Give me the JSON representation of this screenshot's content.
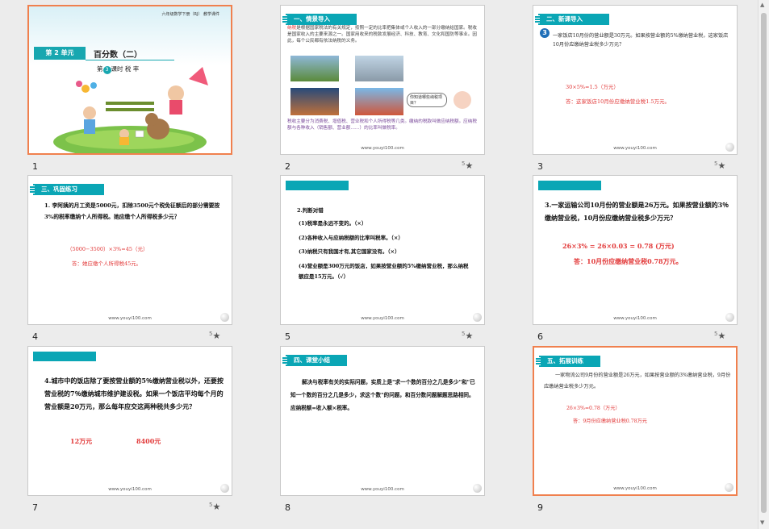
{
  "slides": [
    {
      "num": "1",
      "header": "六年级数学下册（RJ）  教学课件",
      "unit": "第 2 单元",
      "title": "百分数（二）",
      "lesson_pre": "第",
      "lesson_num": "3",
      "lesson_post": "课时  税 率"
    },
    {
      "num": "2",
      "banner": "一、情景导入",
      "text_pre": "纳税",
      "text": "是根据国家税法的有关规定，按照一定的比率把集体或个人收入的一部分缴纳给国家。税收是国家收入的主要来源之一。国家用收来的税款发展经济、科技、教育、文化和国防等事业。因此，每个公民都有依法纳税的义务。",
      "bubble": "你知道哪些纳税项目？",
      "text2": "税收主要分为消费税、增值税、营业税和个人所得税等几类。缴纳的税款叫做应纳税额。应纳税额与各种收入（销售额、营业额……）的比率叫做税率。",
      "footer": "www.youyi100.com"
    },
    {
      "num": "3",
      "banner": "二、新课导入",
      "badge": "3",
      "problem": "一家饭店10月份的营业额是30万元。如果按营业额的5%缴纳营业税，这家饭店10月份应缴纳营业税多少万元？",
      "calc": "30×5%=1.5（万元）",
      "answer": "答：这家饭店10月份应缴纳营业税1.5万元。",
      "footer": "www.youyi100.com"
    },
    {
      "num": "4",
      "banner": "三、巩固练习",
      "problem": "1. 李阿姨的月工资是5000元，扣除3500元个税免征额后的部分需要按3%的税率缴纳个人所得税。她应缴个人所得税多少元？",
      "calc": "（5000−3500）×3%=45（元）",
      "answer": "答：她应缴个人所得税45元。",
      "footer": "www.youyi100.com"
    },
    {
      "num": "5",
      "title": "2.判断对错",
      "items": [
        "(1)税率是永远不变的。（×）",
        "(2)各种收入与应纳税额的比率叫税率。（×）",
        "(3)纳税只有我国才有,其它国家没有。（×）",
        "(4)营业额是300万元的饭店，如果按营业额的5%缴纳营业税，那么纳税额应是15万元。（√）"
      ],
      "footer": "www.youyi100.com"
    },
    {
      "num": "6",
      "problem": "3.一家运输公司10月份的营业额是26万元。如果按营业额的3％缴纳营业税，10月份应缴纳营业税多少万元？",
      "calc": "26×3% = 26×0.03 = 0.78 (万元)",
      "answer": "答：10月份应缴纳营业税0.78万元。",
      "footer": "www.youyi100.com"
    },
    {
      "num": "7",
      "problem": "4.城市中的饭店除了要按营业额的5％缴纳营业税以外，还要按营业税的7％缴纳城市维护建设税。如果一个饭店平均每个月的营业额是20万元，那么每年应交这两种税共多少元？",
      "ans1": "12万元",
      "ans2": "8400元",
      "footer": "www.youyi100.com"
    },
    {
      "num": "8",
      "banner": "四、课堂小结",
      "text": "解决与税率有关的实际问题，实质上是\"求一个数的百分之几是多少\"和\"已知一个数的百分之几是多少，求这个数\"的问题，和百分数问题解题思路相同。应纳税额=收入额×税率。",
      "footer": "www.youyi100.com"
    },
    {
      "num": "9",
      "banner": "五、拓展训练",
      "problem": "一家物流公司9月份的营业额是26万元，如果按营业额的3%缴纳营业税，9月份应缴纳营业税多少万元。",
      "calc": "26×3%=0.78（万元）",
      "answer": "答：9月份应缴纳营业税0.78万元",
      "footer": "www.youyi100.com"
    }
  ],
  "star_symbol": "★",
  "star_sup": "5",
  "scroll": {
    "up": "▲",
    "down": "▼"
  },
  "colors": {
    "accent": "#0aa6b5",
    "selected": "#f0804e",
    "answer_red": "#e23a3a"
  }
}
